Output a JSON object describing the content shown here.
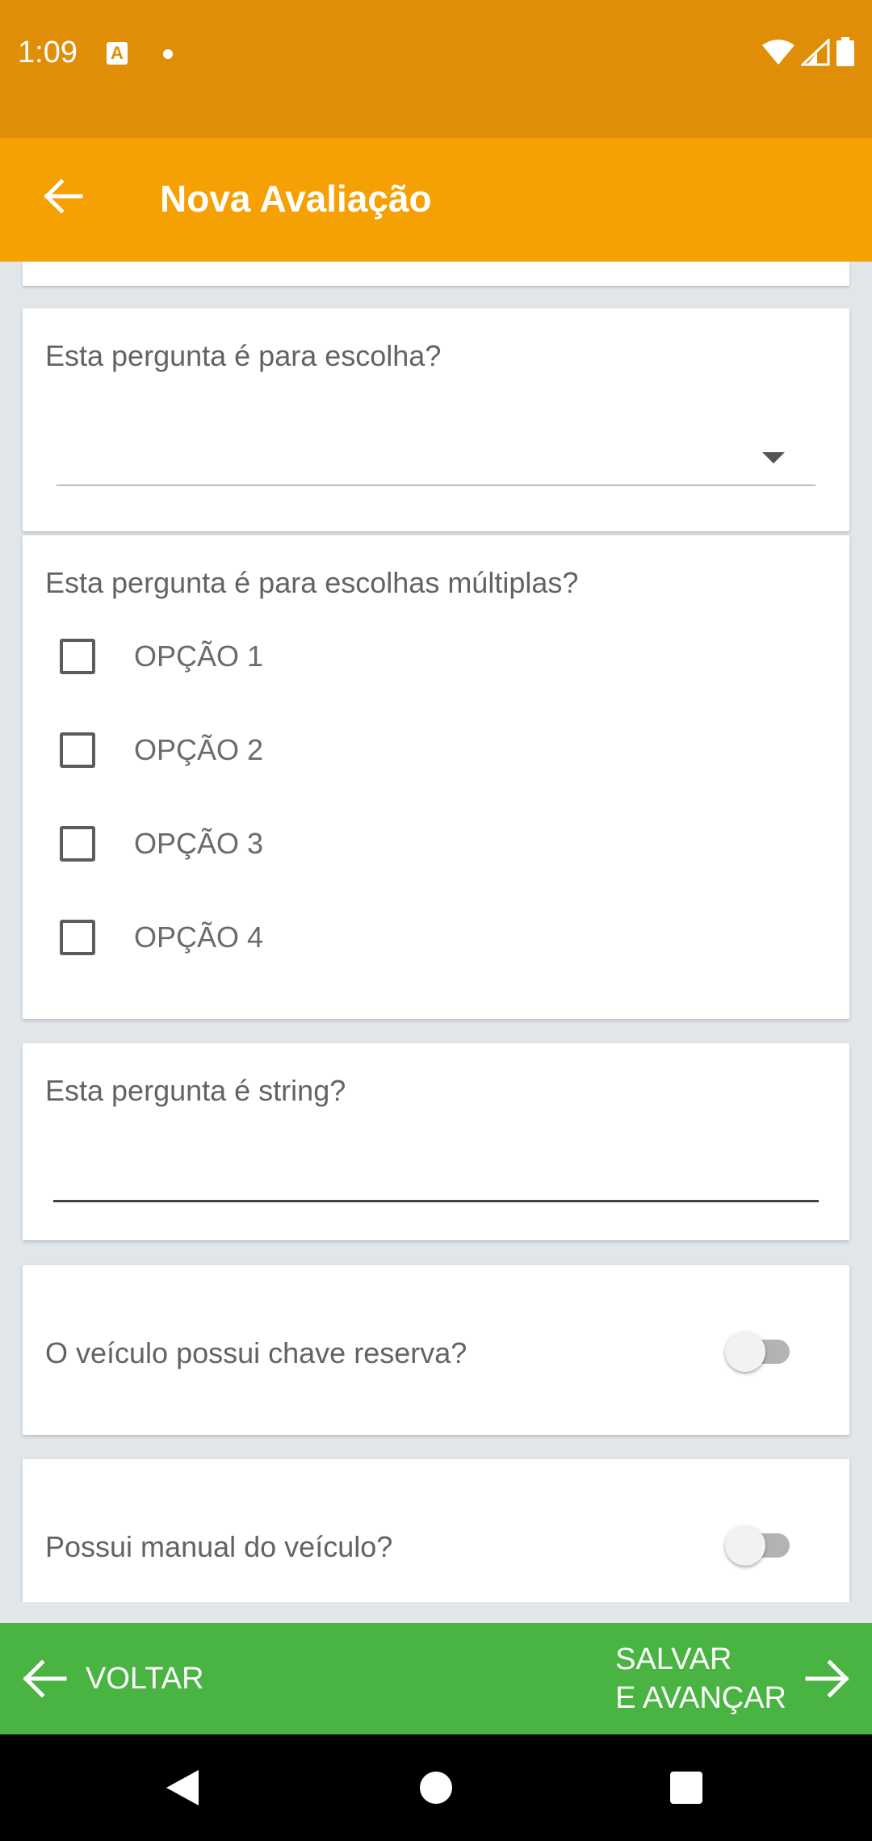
{
  "status_bar": {
    "time": "1:09",
    "notification_icon_letter": "A",
    "icons": [
      "wifi-icon",
      "signal-icon",
      "battery-icon"
    ]
  },
  "app_bar": {
    "title": "Nova Avaliação",
    "back_icon": "arrow-left-icon"
  },
  "questions": {
    "choice": {
      "label": "Esta pergunta é para escolha?",
      "selected": ""
    },
    "multiple": {
      "label": "Esta pergunta é para escolhas múltiplas?",
      "options": [
        "OPÇÃO 1",
        "OPÇÃO 2",
        "OPÇÃO 3",
        "OPÇÃO 4"
      ]
    },
    "string": {
      "label": "Esta pergunta é string?",
      "value": ""
    },
    "spare_key": {
      "label": "O veículo possui chave reserva?",
      "checked": false
    },
    "manual": {
      "label": "Possui manual do veículo?",
      "checked": false
    }
  },
  "bottom_bar": {
    "back_label": "VOLTAR",
    "next_label_line1": "SALVAR",
    "next_label_line2": "E AVANÇAR"
  },
  "colors": {
    "status_bar": "#e08e07",
    "app_bar": "#f5a003",
    "bottom_bar": "#4ab442",
    "background": "#e1e6eb"
  }
}
